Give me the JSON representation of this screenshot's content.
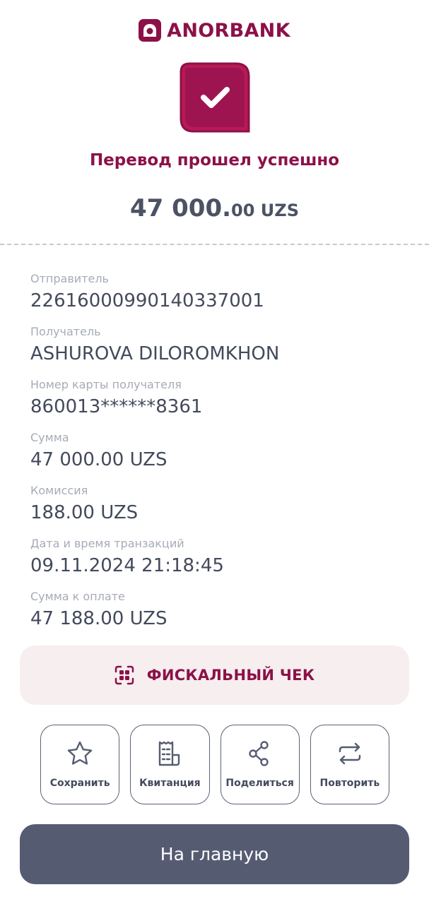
{
  "brand": {
    "name": "ANORBANK",
    "color": "#8c1148"
  },
  "status": {
    "title": "Перевод прошел успешно",
    "icon": "check-icon"
  },
  "amount": {
    "integer": "47 000.",
    "fraction": "00 UZS"
  },
  "details": [
    {
      "label": "Отправитель",
      "value": "22616000990140337001"
    },
    {
      "label": "Получатель",
      "value": "ASHUROVA DILOROMKHON"
    },
    {
      "label": "Номер карты получателя",
      "value": "860013******8361"
    },
    {
      "label": "Сумма",
      "value": "47 000.00 UZS"
    },
    {
      "label": "Комиссия",
      "value": "188.00 UZS"
    },
    {
      "label": "Дата и время транзакций",
      "value": "09.11.2024 21:18:45"
    },
    {
      "label": "Сумма к оплате",
      "value": "47 188.00 UZS"
    }
  ],
  "fiscal": {
    "label": "ФИСКАЛЬНЫЙ ЧЕК",
    "icon": "qr-icon"
  },
  "actions": [
    {
      "label": "Сохранить",
      "icon": "star-icon"
    },
    {
      "label": "Квитанция",
      "icon": "receipt-icon"
    },
    {
      "label": "Поделиться",
      "icon": "share-icon"
    },
    {
      "label": "Повторить",
      "icon": "repeat-icon"
    }
  ],
  "home": {
    "label": "На главную"
  }
}
